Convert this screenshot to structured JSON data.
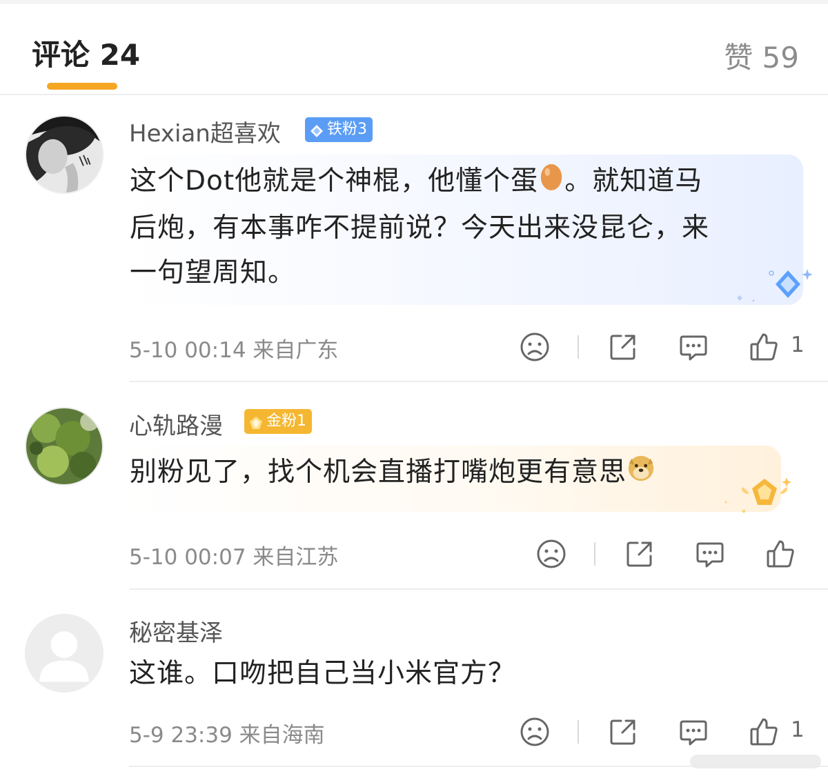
{
  "header": {
    "comments_tab": "评论 24",
    "likes_tab": "赞 59",
    "accent_color": "#f5a623"
  },
  "comments": [
    {
      "username": "Hexian超喜欢",
      "badge": "铁粉3",
      "badge_color": "#5b9df5",
      "text_line1_a": "这个Dot他就是个神棍，他懂个蛋",
      "text_line1_emoji": "egg-emoji",
      "text_line1_b": "。就知道马",
      "text_line2": "后炮，有本事咋不提前说？今天出来没昆仑，来",
      "text_line3": "一句望周知。",
      "meta": "5-10 00:14  来自广东",
      "likes": "1"
    },
    {
      "username": "心轨路漫",
      "badge": "金粉1",
      "badge_color": "#f5b731",
      "text": "别粉见了，找个机会直播打嘴炮更有意思",
      "text_emoji": "doge-emoji",
      "meta": "5-10 00:07  来自江苏",
      "likes": ""
    },
    {
      "username": "秘密基泽",
      "text": "这谁。口吻把自己当小米官方？",
      "meta": "5-9 23:39  来自海南",
      "likes": "1"
    }
  ]
}
